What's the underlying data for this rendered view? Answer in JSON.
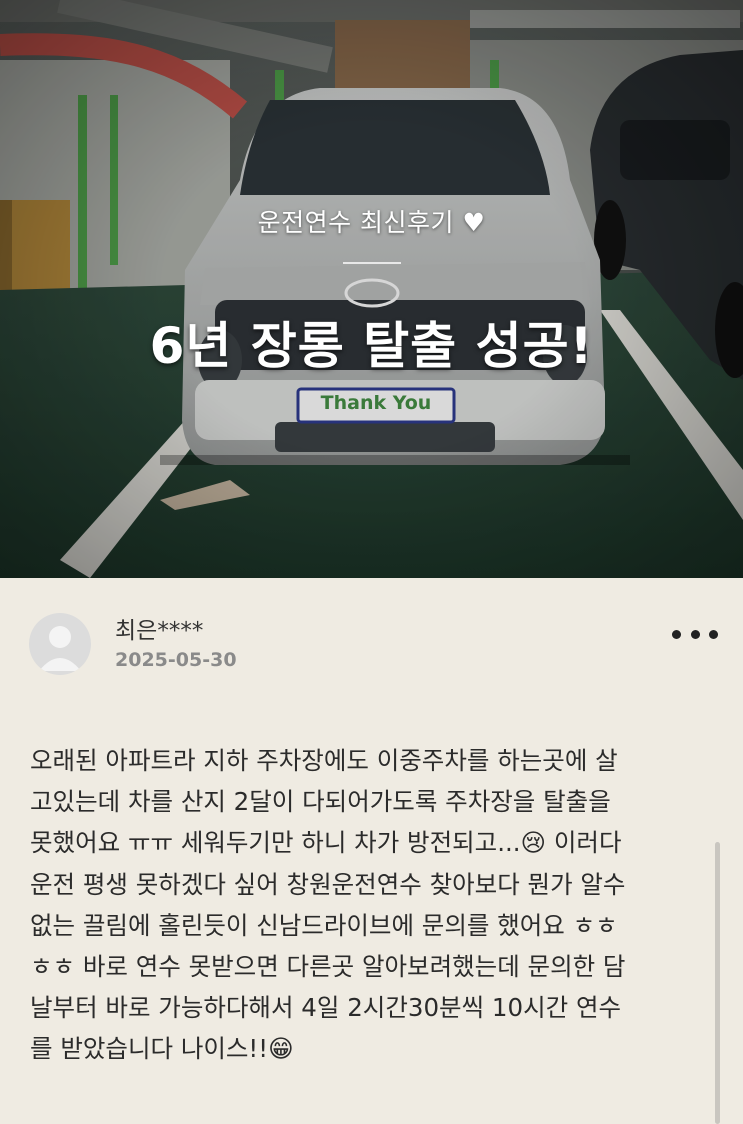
{
  "hero": {
    "subtitle": "운전연수 최신후기 ♥",
    "title": "6년 장롱 탈출 성공!",
    "plate_text": "Thank You"
  },
  "review": {
    "author": "최은****",
    "date": "2025-05-30",
    "lines": [
      "오래된 아파트라 지하 주차장에도 이중주차를 하는곳에 살",
      "고있는데 차를 산지 2달이 다되어가도록 주차장을 탈출을",
      "못했어요 ㅠㅠ 세워두기만 하니 차가 방전되고...😢 이러다",
      "운전 평생 못하겠다 싶어 창원운전연수 찾아보다 뭔가 알수",
      "없는 끌림에 홀린듯이 신남드라이브에 문의를 했어요 ㅎㅎ",
      "ㅎㅎ 바로 연수 못받으면 다른곳 알아보려했는데 문의한 담",
      "날부터 바로 가능하다해서 4일 2시간30분씩 10시간 연수",
      "를 받았습니다 나이스!!😁"
    ]
  },
  "icons": {
    "avatar": "user-avatar-icon",
    "more": "more-horizontal-icon"
  },
  "colors": {
    "background": "#efebe2",
    "text": "#2b2b2b",
    "date": "#8a8a8a"
  }
}
